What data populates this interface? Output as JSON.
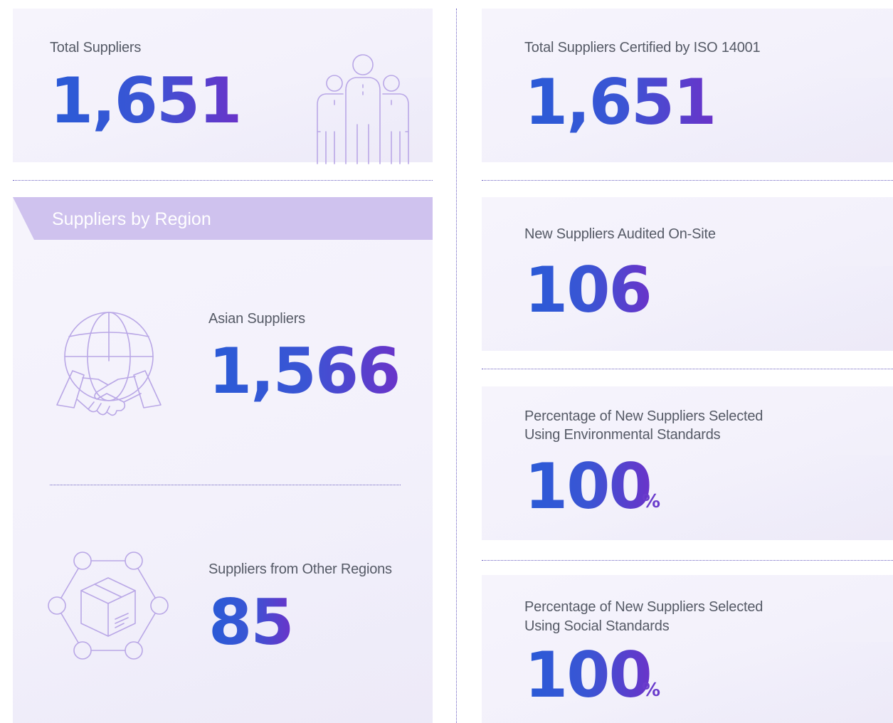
{
  "total_suppliers": {
    "label": "Total Suppliers",
    "value": "1,651"
  },
  "region": {
    "title": "Suppliers by Region",
    "asian": {
      "label": "Asian Suppliers",
      "value": "1,566"
    },
    "other": {
      "label": "Suppliers from Other Regions",
      "value": "85"
    }
  },
  "iso": {
    "label": "Total Suppliers Certified by ISO 14001",
    "value": "1,651"
  },
  "audited": {
    "label": "New Suppliers Audited On-Site",
    "value": "106"
  },
  "env": {
    "label_line1": "Percentage of New Suppliers Selected",
    "label_line2": "Using Environmental Standards",
    "value": "100",
    "unit": "%"
  },
  "social": {
    "label_line1": "Percentage of New Suppliers Selected",
    "label_line2": "Using Social Standards",
    "value": "100",
    "unit": "%"
  },
  "icons": [
    "people-group-icon",
    "globe-handshake-icon",
    "network-box-icon"
  ],
  "colors": {
    "accent_blue": "#2a5bd7",
    "accent_purple": "#6a33c9",
    "banner": "#cfc2ee",
    "icon_stroke": "#b9a7e6"
  }
}
